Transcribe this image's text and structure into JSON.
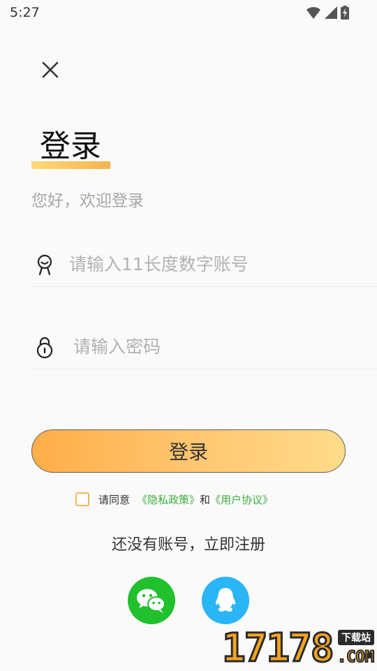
{
  "status_bar": {
    "time": "5:27",
    "icons": [
      "wifi-icon",
      "cell-signal-icon",
      "battery-charging-icon"
    ]
  },
  "header": {
    "close_icon": "close-icon"
  },
  "title": "登录",
  "subtitle": "您好，欢迎登录",
  "account_field": {
    "icon": "person-icon",
    "placeholder": "请输入11长度数字账号",
    "value": ""
  },
  "password_field": {
    "icon": "lock-icon",
    "placeholder": "请输入密码",
    "value": ""
  },
  "login_button": {
    "label": "登录"
  },
  "agreement": {
    "prefix": "请同意",
    "privacy_link": "《隐私政策》",
    "joiner": "和",
    "terms_link": "《用户协议》",
    "checked": false
  },
  "register_link": "还没有账号，立即注册",
  "social_login": [
    {
      "name": "wechat",
      "icon": "wechat-icon",
      "color": "#21c02d"
    },
    {
      "name": "qq",
      "icon": "qq-icon",
      "color": "#29b5f6"
    }
  ],
  "watermark": {
    "digits": "17178",
    "site_label": "下载站",
    "suffix": ".COM"
  },
  "colors": {
    "accent": "#ffb24e",
    "link_green": "#3dae3d",
    "placeholder": "#b2b2b2"
  }
}
